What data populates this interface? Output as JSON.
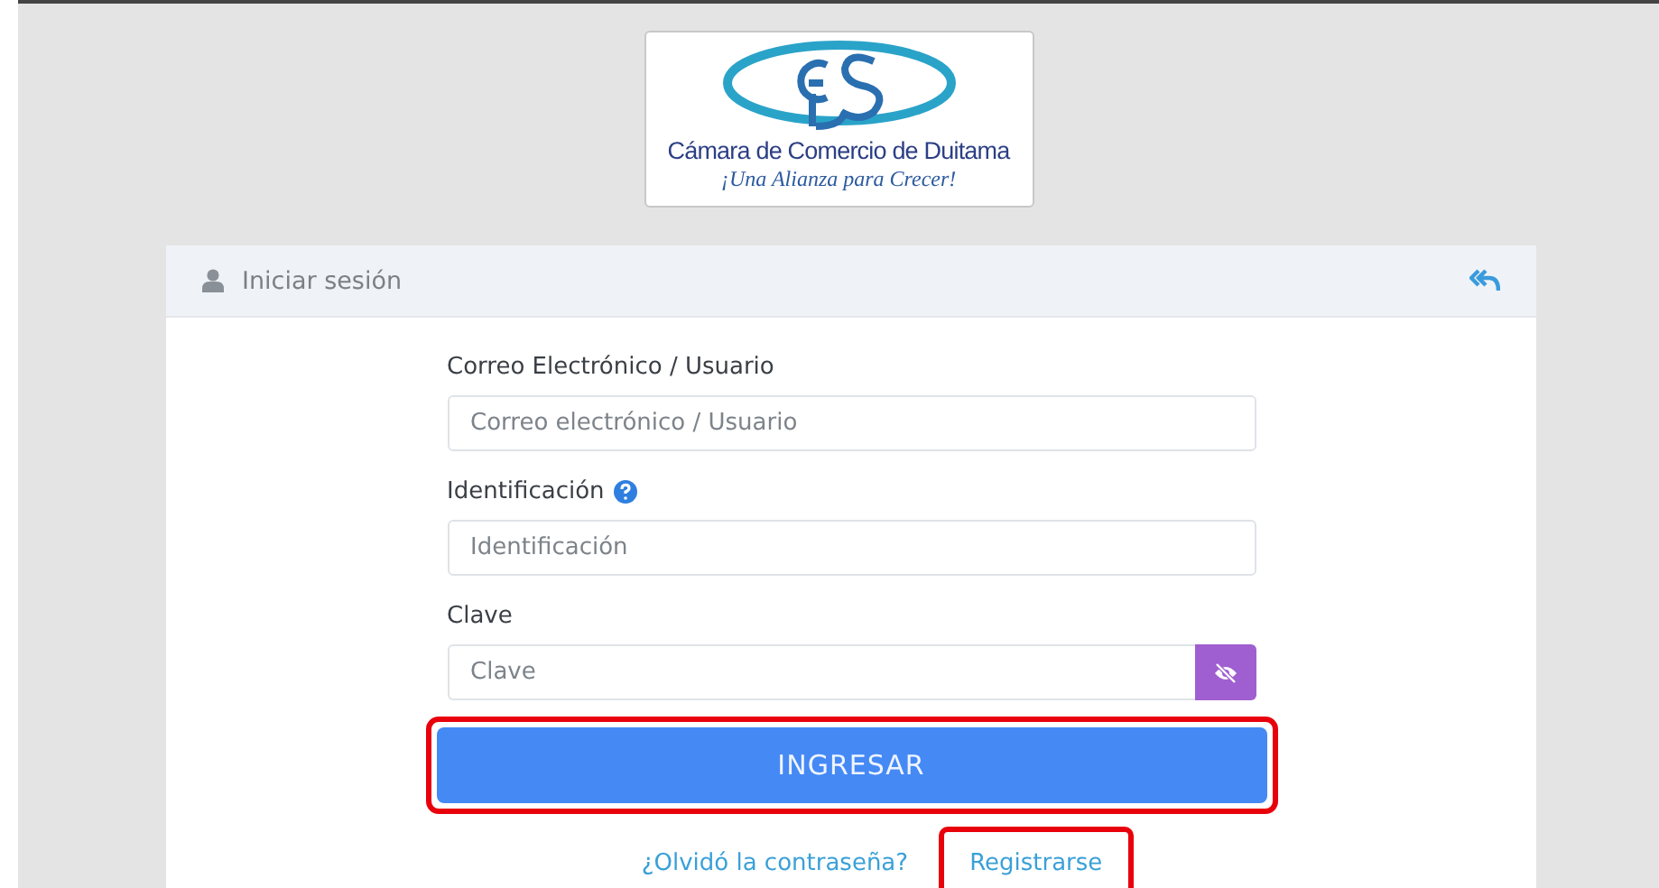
{
  "logo": {
    "name": "Cámara de Comercio de Duitama",
    "slogan": "¡Una Alianza para Crecer!"
  },
  "card": {
    "title": "Iniciar sesión"
  },
  "fields": [
    {
      "label": "Correo Electrónico / Usuario",
      "placeholder": "Correo electrónico / Usuario",
      "kind": "text",
      "help": false
    },
    {
      "label": "Identificación",
      "placeholder": "Identificación",
      "kind": "text",
      "help": true
    },
    {
      "label": "Clave",
      "placeholder": "Clave",
      "kind": "password",
      "help": false
    }
  ],
  "login_button": {
    "label": "INGRESAR",
    "highlighted": true
  },
  "links": [
    {
      "label": "¿Olvidó la contraseña?",
      "highlighted": false
    },
    {
      "label": "Registrarse",
      "highlighted": true
    }
  ]
}
